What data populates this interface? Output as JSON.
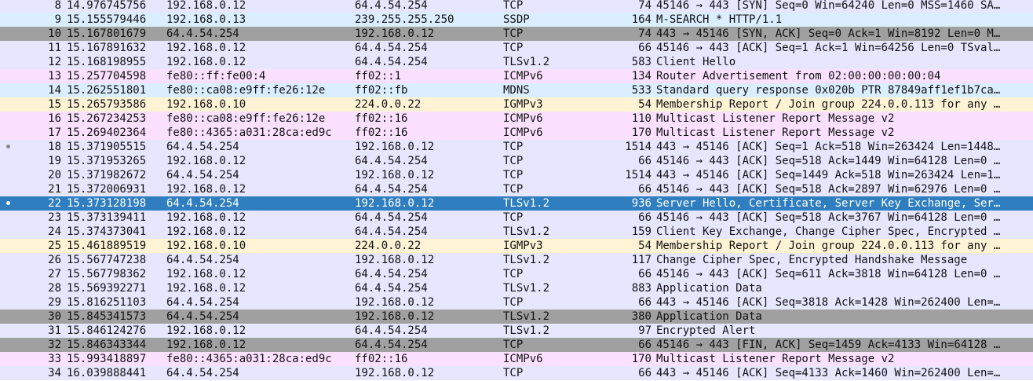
{
  "packets": [
    {
      "no": "8",
      "time": "14.976745756",
      "src": "192.168.0.12",
      "dst": "64.4.54.254",
      "proto": "TCP",
      "len": "74",
      "info": "45146 → 443 [SYN] Seq=0 Win=64240 Len=0 MSS=1460 SA…",
      "style": "tcp"
    },
    {
      "no": "9",
      "time": "15.155579446",
      "src": "192.168.0.13",
      "dst": "239.255.255.250",
      "proto": "SSDP",
      "len": "164",
      "info": "M-SEARCH * HTTP/1.1",
      "style": "udp"
    },
    {
      "no": "10",
      "time": "15.167801679",
      "src": "64.4.54.254",
      "dst": "192.168.0.12",
      "proto": "TCP",
      "len": "74",
      "info": "443 → 45146 [SYN, ACK] Seq=0 Ack=1 Win=8192 Len=0 M…",
      "style": "tcpbad"
    },
    {
      "no": "11",
      "time": "15.167891632",
      "src": "192.168.0.12",
      "dst": "64.4.54.254",
      "proto": "TCP",
      "len": "66",
      "info": "45146 → 443 [ACK] Seq=1 Ack=1 Win=64256 Len=0 TSval…",
      "style": "tcp"
    },
    {
      "no": "12",
      "time": "15.168198955",
      "src": "192.168.0.12",
      "dst": "64.4.54.254",
      "proto": "TLSv1.2",
      "len": "583",
      "info": "Client Hello",
      "style": "tcp"
    },
    {
      "no": "13",
      "time": "15.257704598",
      "src": "fe80::ff:fe00:4",
      "dst": "ff02::1",
      "proto": "ICMPv6",
      "len": "134",
      "info": "Router Advertisement from 02:00:00:00:00:04",
      "style": "icmp"
    },
    {
      "no": "14",
      "time": "15.262551801",
      "src": "fe80::ca08:e9ff:fe26:12e",
      "dst": "ff02::fb",
      "proto": "MDNS",
      "len": "533",
      "info": "Standard query response 0x020b PTR 87849aff1ef1b7ca…",
      "style": "udp"
    },
    {
      "no": "15",
      "time": "15.265793586",
      "src": "192.168.0.10",
      "dst": "224.0.0.22",
      "proto": "IGMPv3",
      "len": "54",
      "info": "Membership Report / Join group 224.0.0.113 for any …",
      "style": "igmp"
    },
    {
      "no": "16",
      "time": "15.267234253",
      "src": "fe80::ca08:e9ff:fe26:12e",
      "dst": "ff02::16",
      "proto": "ICMPv6",
      "len": "110",
      "info": "Multicast Listener Report Message v2",
      "style": "icmp"
    },
    {
      "no": "17",
      "time": "15.269402364",
      "src": "fe80::4365:a031:28ca:ed9c",
      "dst": "ff02::16",
      "proto": "ICMPv6",
      "len": "170",
      "info": "Multicast Listener Report Message v2",
      "style": "icmp"
    },
    {
      "no": "18",
      "time": "15.371905515",
      "src": "64.4.54.254",
      "dst": "192.168.0.12",
      "proto": "TCP",
      "len": "1514",
      "info": "443 → 45146 [ACK] Seq=1 Ack=518 Win=263424 Len=1448…",
      "style": "tcp"
    },
    {
      "no": "19",
      "time": "15.371953265",
      "src": "192.168.0.12",
      "dst": "64.4.54.254",
      "proto": "TCP",
      "len": "66",
      "info": "45146 → 443 [ACK] Seq=518 Ack=1449 Win=64128 Len=0 …",
      "style": "tcp"
    },
    {
      "no": "20",
      "time": "15.371982672",
      "src": "64.4.54.254",
      "dst": "192.168.0.12",
      "proto": "TCP",
      "len": "1514",
      "info": "443 → 45146 [ACK] Seq=1449 Ack=518 Win=263424 Len=1…",
      "style": "tcp"
    },
    {
      "no": "21",
      "time": "15.372006931",
      "src": "192.168.0.12",
      "dst": "64.4.54.254",
      "proto": "TCP",
      "len": "66",
      "info": "45146 → 443 [ACK] Seq=518 Ack=2897 Win=62976 Len=0 …",
      "style": "tcp"
    },
    {
      "no": "22",
      "time": "15.373128198",
      "src": "64.4.54.254",
      "dst": "192.168.0.12",
      "proto": "TLSv1.2",
      "len": "936",
      "info": "Server Hello, Certificate, Server Key Exchange, Ser…",
      "style": "selected"
    },
    {
      "no": "23",
      "time": "15.373139411",
      "src": "192.168.0.12",
      "dst": "64.4.54.254",
      "proto": "TCP",
      "len": "66",
      "info": "45146 → 443 [ACK] Seq=518 Ack=3767 Win=64128 Len=0 …",
      "style": "tcp"
    },
    {
      "no": "24",
      "time": "15.374373041",
      "src": "192.168.0.12",
      "dst": "64.4.54.254",
      "proto": "TLSv1.2",
      "len": "159",
      "info": "Client Key Exchange, Change Cipher Spec, Encrypted …",
      "style": "tcp"
    },
    {
      "no": "25",
      "time": "15.461889519",
      "src": "192.168.0.10",
      "dst": "224.0.0.22",
      "proto": "IGMPv3",
      "len": "54",
      "info": "Membership Report / Join group 224.0.0.113 for any …",
      "style": "igmp"
    },
    {
      "no": "26",
      "time": "15.567747238",
      "src": "64.4.54.254",
      "dst": "192.168.0.12",
      "proto": "TLSv1.2",
      "len": "117",
      "info": "Change Cipher Spec, Encrypted Handshake Message",
      "style": "tcp"
    },
    {
      "no": "27",
      "time": "15.567798362",
      "src": "192.168.0.12",
      "dst": "64.4.54.254",
      "proto": "TCP",
      "len": "66",
      "info": "45146 → 443 [ACK] Seq=611 Ack=3818 Win=64128 Len=0 …",
      "style": "tcp"
    },
    {
      "no": "28",
      "time": "15.569392271",
      "src": "192.168.0.12",
      "dst": "64.4.54.254",
      "proto": "TLSv1.2",
      "len": "883",
      "info": "Application Data",
      "style": "tcp"
    },
    {
      "no": "29",
      "time": "15.816251103",
      "src": "64.4.54.254",
      "dst": "192.168.0.12",
      "proto": "TCP",
      "len": "66",
      "info": "443 → 45146 [ACK] Seq=3818 Ack=1428 Win=262400 Len=…",
      "style": "tcp"
    },
    {
      "no": "30",
      "time": "15.845341573",
      "src": "64.4.54.254",
      "dst": "192.168.0.12",
      "proto": "TLSv1.2",
      "len": "380",
      "info": "Application Data",
      "style": "tcpbad"
    },
    {
      "no": "31",
      "time": "15.846124276",
      "src": "192.168.0.12",
      "dst": "64.4.54.254",
      "proto": "TLSv1.2",
      "len": "97",
      "info": "Encrypted Alert",
      "style": "tcp"
    },
    {
      "no": "32",
      "time": "15.846343344",
      "src": "192.168.0.12",
      "dst": "64.4.54.254",
      "proto": "TCP",
      "len": "66",
      "info": "45146 → 443 [FIN, ACK] Seq=1459 Ack=4133 Win=64128 …",
      "style": "tcpbad"
    },
    {
      "no": "33",
      "time": "15.993418897",
      "src": "fe80::4365:a031:28ca:ed9c",
      "dst": "ff02::16",
      "proto": "ICMPv6",
      "len": "170",
      "info": "Multicast Listener Report Message v2",
      "style": "icmp"
    },
    {
      "no": "34",
      "time": "16.039888441",
      "src": "64.4.54.254",
      "dst": "192.168.0.12",
      "proto": "TCP",
      "len": "66",
      "info": "443 → 45146 [ACK] Seq=4133 Ack=1460 Win=262400 Len=…",
      "style": "tcp"
    }
  ],
  "colors": {
    "tcp": "#e7e6ff",
    "udp": "#daeeff",
    "tcp_bad": "#a0a0a0",
    "icmp": "#fce0ff",
    "igmp": "#fff3d6",
    "selected": "#2f7ebf"
  }
}
